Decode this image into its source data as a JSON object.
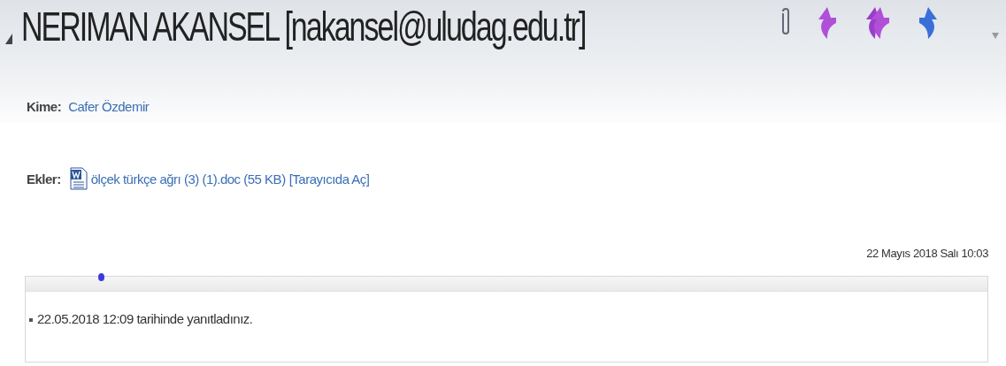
{
  "sender": {
    "title": "NERIMAN AKANSEL [nakansel@uludag.edu.tr]"
  },
  "recipients": {
    "label": "Kime:",
    "value": "Cafer Özdemir"
  },
  "attachments": {
    "label": "Ekler:",
    "file": "ölçek türkçe ağrı (3) (1).doc (55 KB)",
    "open_link": "[Tarayıcıda Aç]"
  },
  "date": "22 Mayıs 2018 Salı 10:03",
  "notes": [
    "22.05.2018 12:09 tarihinde yanıtladınız."
  ]
}
